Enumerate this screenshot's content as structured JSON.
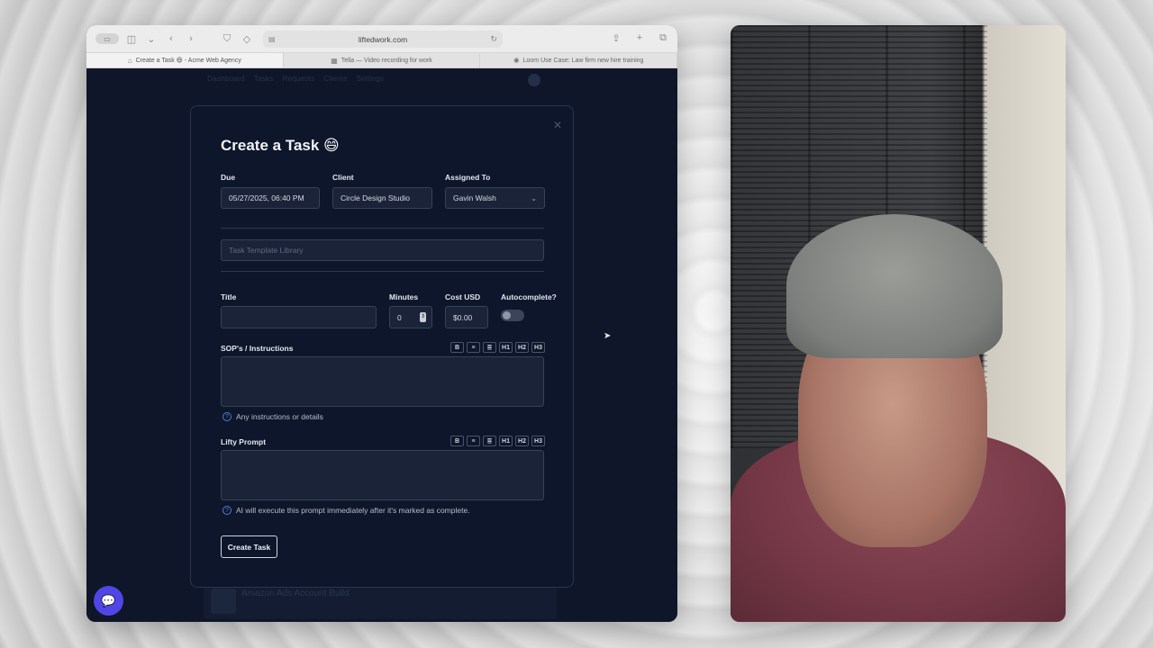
{
  "browser": {
    "url": "liftedwork.com",
    "tabs": [
      {
        "label": "Create a Task 😄 - Acme Web Agency",
        "icon": "house-icon"
      },
      {
        "label": "Tella — Video recording for work",
        "icon": "tella-icon"
      },
      {
        "label": "Loom Use Case: Law firm new hire training",
        "icon": "loom-icon"
      }
    ]
  },
  "app_nav": [
    "Dashboard",
    "Tasks",
    "Requests",
    "Clients",
    "Settings"
  ],
  "background_row": {
    "title": "Amazon Ads Account Build"
  },
  "modal": {
    "title": "Create a Task 😄",
    "due": {
      "label": "Due",
      "value": "05/27/2025, 06:40 PM"
    },
    "client": {
      "label": "Client",
      "value": "Circle Design Studio"
    },
    "assigned": {
      "label": "Assigned To",
      "value": "Gavin Walsh"
    },
    "template": {
      "placeholder": "Task Template Library"
    },
    "title_field": {
      "label": "Title",
      "value": ""
    },
    "minutes": {
      "label": "Minutes",
      "value": "0"
    },
    "cost": {
      "label": "Cost USD",
      "value": "$0.00"
    },
    "autocomplete": {
      "label": "Autocomplete?",
      "on": false
    },
    "sop": {
      "label": "SOP's / Instructions",
      "help": "Any instructions or details"
    },
    "prompt": {
      "label": "Lifty Prompt",
      "help": "AI will execute this prompt immediately after it's marked as complete."
    },
    "format_buttons": [
      "B",
      "≡",
      "≣",
      "H1",
      "H2",
      "H3"
    ],
    "submit": "Create Task"
  },
  "colors": {
    "accent": "#4f46e5",
    "modal_bg": "#0d162b",
    "page_bg": "#0f1629"
  }
}
